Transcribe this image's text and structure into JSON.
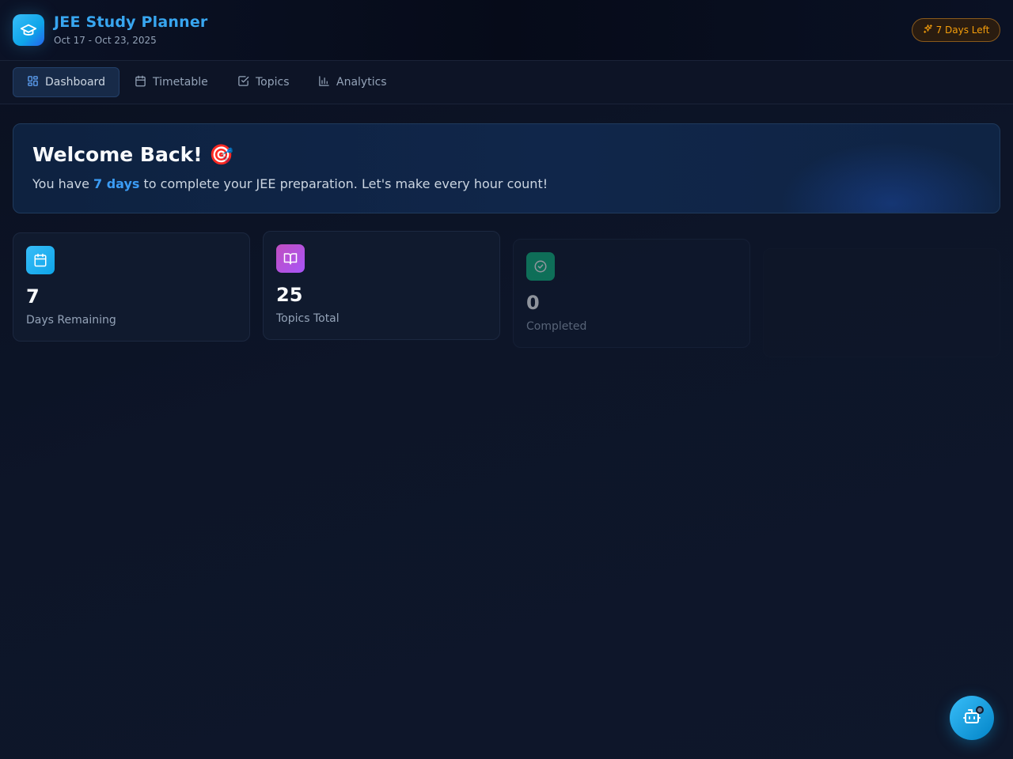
{
  "header": {
    "title": "JEE Study Planner",
    "dates": "Oct 17 - Oct 23, 2025",
    "badge": "7 Days Left",
    "logo_icon": "graduation-cap-icon",
    "badge_icon": "sparkles-icon"
  },
  "nav": {
    "tabs": [
      {
        "label": "Dashboard",
        "icon": "dashboard-grid-icon",
        "active": true
      },
      {
        "label": "Timetable",
        "icon": "calendar-icon",
        "active": false
      },
      {
        "label": "Topics",
        "icon": "check-square-icon",
        "active": false
      },
      {
        "label": "Analytics",
        "icon": "bar-chart-icon",
        "active": false
      }
    ]
  },
  "welcome": {
    "title": "Welcome Back! 🎯",
    "text_before": "You have ",
    "highlight": "7 days",
    "text_after": " to complete your JEE preparation. Let's make every hour count!"
  },
  "stats": [
    {
      "value": "7",
      "label": "Days Remaining",
      "icon": "calendar-icon",
      "color": "#38a6f0"
    },
    {
      "value": "25",
      "label": "Topics Total",
      "icon": "book-open-icon",
      "color": "#c04ec0"
    },
    {
      "value": "0",
      "label": "Completed",
      "icon": "check-circle-icon",
      "color": "#10b981"
    }
  ],
  "assistant": {
    "icon": "bot-icon"
  },
  "colors": {
    "accent": "#38a6f0",
    "badge": "#f59e0b",
    "background": "#0d1528"
  }
}
